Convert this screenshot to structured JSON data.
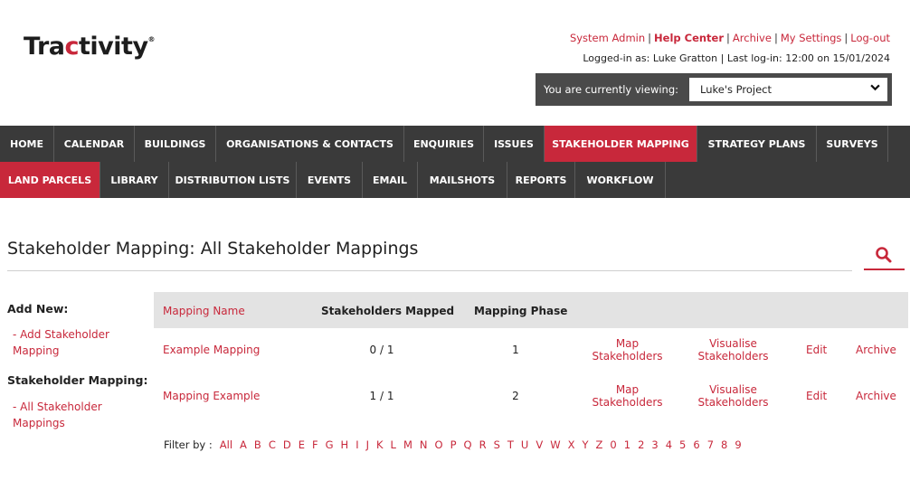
{
  "brand": {
    "logo_part1": "Tra",
    "logo_accent": "c",
    "logo_part2": "tivity",
    "logo_mark": "®"
  },
  "header": {
    "links": [
      "System Admin",
      "Help Center",
      "Archive",
      "My Settings",
      "Log-out"
    ],
    "logged_in_text": "Logged-in as: Luke Gratton | Last log-in: 12:00 on 15/01/2024",
    "viewing_label": "You are currently viewing:",
    "viewing_value": "Luke's Project"
  },
  "nav_primary": [
    {
      "label": "HOME",
      "active": false
    },
    {
      "label": "CALENDAR",
      "active": false
    },
    {
      "label": "BUILDINGS",
      "active": false
    },
    {
      "label": "ORGANISATIONS & CONTACTS",
      "active": false
    },
    {
      "label": "ENQUIRIES",
      "active": false
    },
    {
      "label": "ISSUES",
      "active": false
    },
    {
      "label": "STAKEHOLDER MAPPING",
      "active": true
    },
    {
      "label": "STRATEGY PLANS",
      "active": false
    },
    {
      "label": "SURVEYS",
      "active": false
    }
  ],
  "nav_secondary": [
    {
      "label": "LAND PARCELS",
      "active": true
    },
    {
      "label": "LIBRARY",
      "active": false
    },
    {
      "label": "DISTRIBUTION LISTS",
      "active": false
    },
    {
      "label": "EVENTS",
      "active": false
    },
    {
      "label": "EMAIL",
      "active": false
    },
    {
      "label": "MAILSHOTS",
      "active": false
    },
    {
      "label": "REPORTS",
      "active": false
    },
    {
      "label": "WORKFLOW",
      "active": false
    }
  ],
  "page": {
    "title": "Stakeholder Mapping: All Stakeholder Mappings"
  },
  "sidebar": {
    "add_new_heading": "Add New:",
    "add_link": "- Add Stakeholder Mapping",
    "section_heading": "Stakeholder Mapping:",
    "all_link": "- All Stakeholder Mappings"
  },
  "table": {
    "headers": [
      "Mapping Name",
      "Stakeholders Mapped",
      "Mapping Phase"
    ],
    "rows": [
      {
        "name": "Example Mapping",
        "mapped": "0 / 1",
        "phase": "1",
        "map": "Map Stakeholders",
        "visualise": "Visualise Stakeholders",
        "edit": "Edit",
        "archive": "Archive"
      },
      {
        "name": "Mapping Example",
        "mapped": "1 / 1",
        "phase": "2",
        "map": "Map Stakeholders",
        "visualise": "Visualise Stakeholders",
        "edit": "Edit",
        "archive": "Archive"
      }
    ]
  },
  "filter": {
    "label": "Filter by :",
    "letters": [
      "All",
      "A",
      "B",
      "C",
      "D",
      "E",
      "F",
      "G",
      "H",
      "I",
      "J",
      "K",
      "L",
      "M",
      "N",
      "O",
      "P",
      "Q",
      "R",
      "S",
      "T",
      "U",
      "V",
      "W",
      "X",
      "Y",
      "Z",
      "0",
      "1",
      "2",
      "3",
      "4",
      "5",
      "6",
      "7",
      "8",
      "9"
    ]
  },
  "colors": {
    "accent": "#c8283b",
    "nav_bg": "#3a3a3a",
    "header_row_bg": "#e3e3e3"
  },
  "icons": {
    "search": "search-icon",
    "dropdown": "chevron-down-icon"
  }
}
